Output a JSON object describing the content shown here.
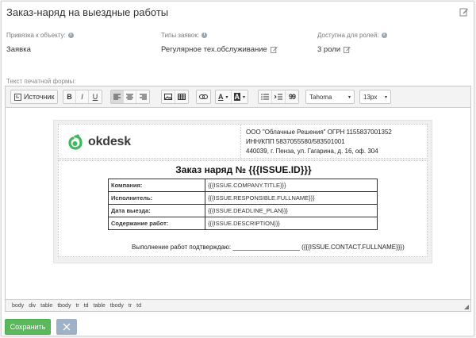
{
  "window": {
    "title": "Заказ-наряд на выездные работы"
  },
  "fields": {
    "object_binding": {
      "label": "Привязка к объекту:",
      "value": "Заявка"
    },
    "request_types": {
      "label": "Типы заявок:",
      "value": "Регулярное тех.обслуживание"
    },
    "roles": {
      "label": "Доступна для ролей:",
      "value": "3 роли"
    }
  },
  "editor": {
    "label": "Текст печатной формы:",
    "toolbar": {
      "source_label": "Источник",
      "bold": "B",
      "italic": "I",
      "underline": "U",
      "text_color_label": "A",
      "bg_color_label": "A",
      "quote_label": "99",
      "font_family": "Tahoma",
      "font_size": "13px"
    },
    "document": {
      "logo_text": "okdesk",
      "company_lines": [
        "ООО \"Облачные Решения\" ОГРН 1155837001352",
        "ИНН/КПП 5837055580/583501001",
        "440039, г. Пенза, ул. Гагарина, д. 16, оф. 304"
      ],
      "title": "Заказ наряд № {{{ISSUE.ID}}}",
      "rows": [
        {
          "key": "Компания:",
          "value": "{{{ISSUE.COMPANY.TITLE}}}"
        },
        {
          "key": "Исполнитель:",
          "value": "{{{ISSUE.RESPONSIBLE.FULLNAME}}}"
        },
        {
          "key": "Дата выезда:",
          "value": "{{{ISSUE.DEADLINE_PLAN}}}"
        },
        {
          "key": "Содержание работ:",
          "value": "{{{ISSUE.DESCRIPTION}}}"
        }
      ],
      "confirm_text": "Выполнение работ подтверждаю: ___________________ ({{{ISSUE.CONTACT.FULLNAME}}})"
    },
    "path": [
      "body",
      "div",
      "table",
      "tbody",
      "tr",
      "td",
      "table",
      "tbody",
      "tr",
      "td"
    ]
  },
  "actions": {
    "save_label": "Сохранить"
  },
  "colors": {
    "save": "#5cb85c",
    "cancel": "#9eb1c7",
    "logo_green": "#3cb95e"
  }
}
